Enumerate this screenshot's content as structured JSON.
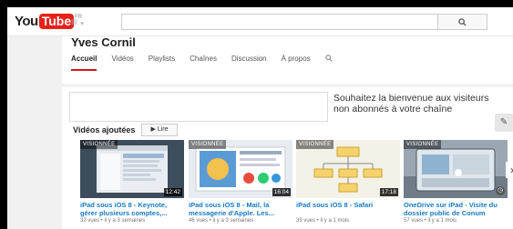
{
  "header": {
    "logo_you": "You",
    "logo_tube": "Tube",
    "logo_region": "FR",
    "guide_icon": "≡",
    "search_placeholder": "",
    "search_icon": "🔍"
  },
  "channel": {
    "name": "Yves Cornil",
    "tabs": [
      {
        "label": "Accueil",
        "active": true
      },
      {
        "label": "Vidéos",
        "active": false
      },
      {
        "label": "Playlists",
        "active": false
      },
      {
        "label": "Chaînes",
        "active": false
      },
      {
        "label": "Discussion",
        "active": false
      },
      {
        "label": "À propos",
        "active": false
      }
    ]
  },
  "main": {
    "welcome_message": "Souhaitez la bienvenue aux visiteurs non abonnés à votre chaîne",
    "section_title": "Vidéos ajoutées",
    "play_all_label": "▶ Lire",
    "videos": [
      {
        "overlay": "VISIONNÉE",
        "duration": "12:42",
        "title": "iPad sous iOS 8 - Keynote, gérer plusieurs comptes,...",
        "meta": "32 vues • il y a 3 semaines"
      },
      {
        "overlay": "VISIONNÉE",
        "duration": "16:04",
        "title": "iPad sous iOS 8 - Mail, la messagerie d'Apple. Les...",
        "meta": "46 vues • il y a 3 semaines"
      },
      {
        "overlay": "VISIONNÉE",
        "duration": "17:18",
        "title": "iPad sous iOS 8 - Safari",
        "meta": "39 vues • il y a 1 mois"
      },
      {
        "overlay": "VISIONNÉE",
        "duration": "",
        "title": "OneDrive sur iPad - Visite du dossier public de Conum",
        "meta": "57 vues • il y a 1 mois"
      }
    ]
  },
  "colors": {
    "brand_red": "#e62117",
    "link_blue": "#167ac6"
  }
}
